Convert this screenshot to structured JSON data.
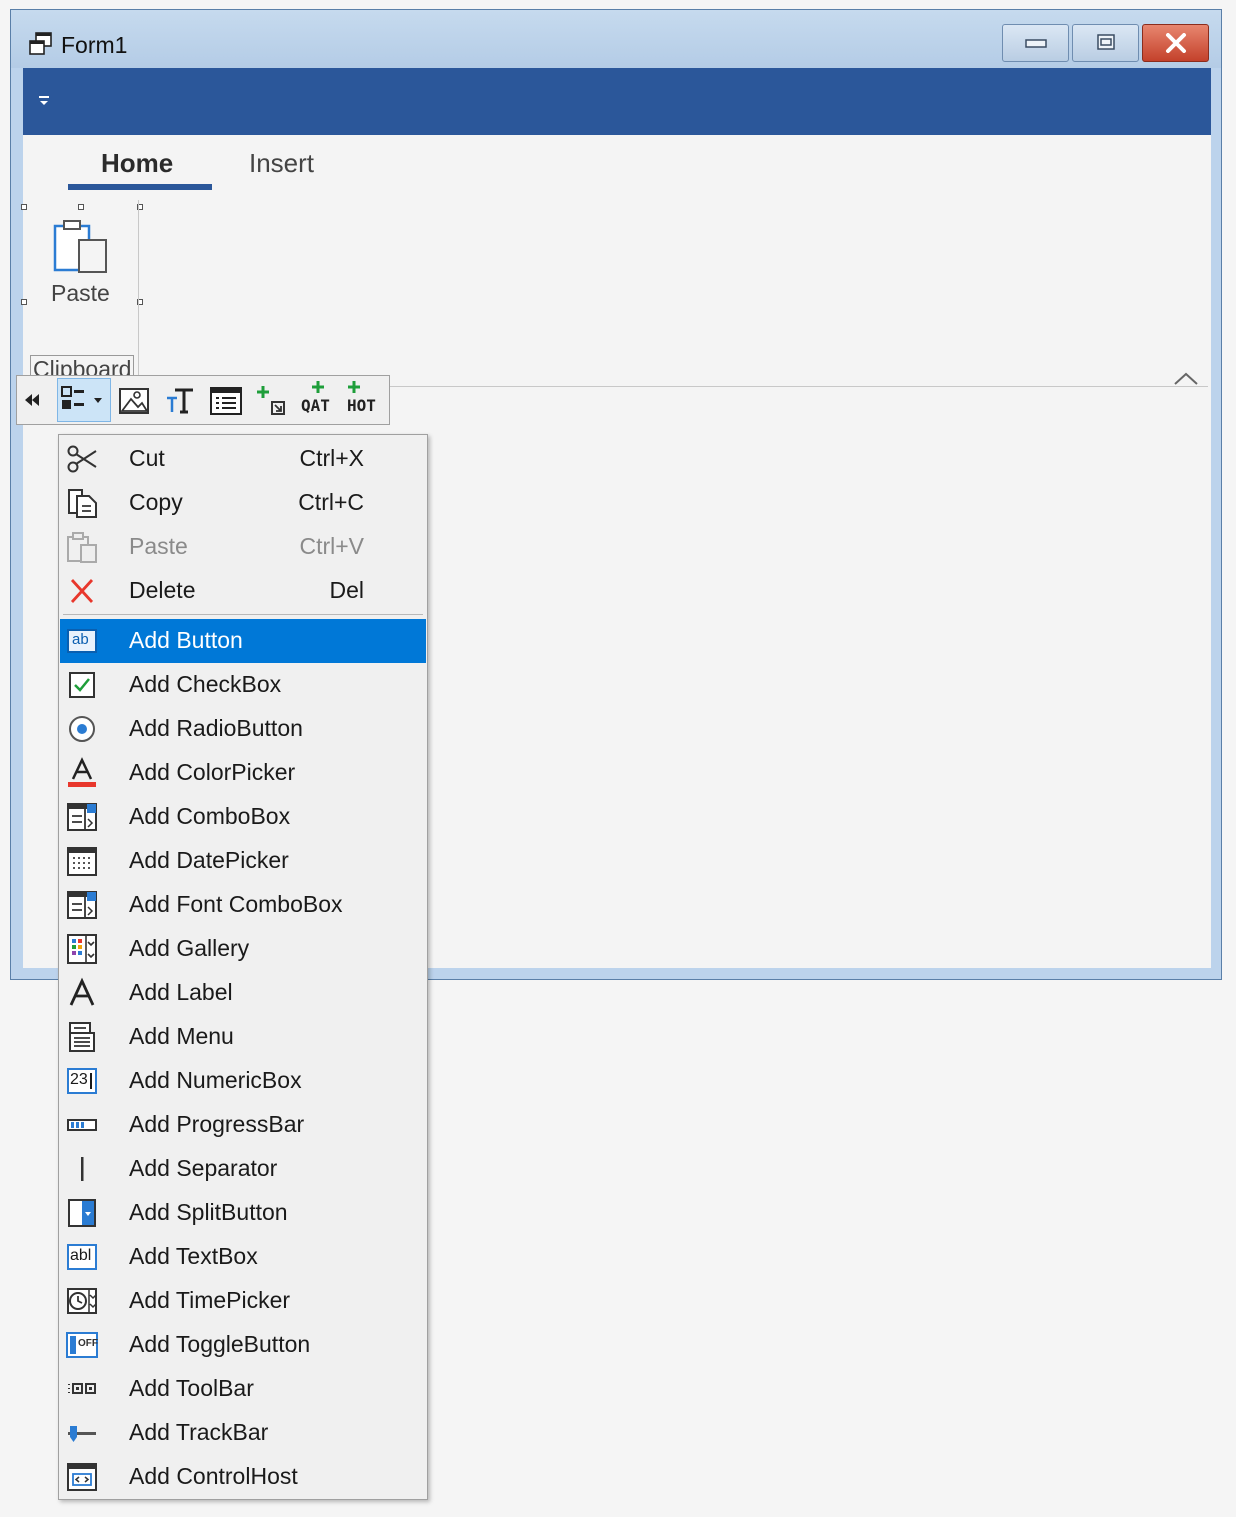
{
  "window": {
    "title": "Form1",
    "icon": "form-icon"
  },
  "ribbon": {
    "tabs": [
      {
        "label": "Home",
        "selected": true
      },
      {
        "label": "Insert",
        "selected": false
      }
    ],
    "group": {
      "name": "Clipboard",
      "buttons": [
        {
          "label": "Paste",
          "icon": "paste-icon"
        }
      ]
    }
  },
  "designer_toolbar": {
    "icons": [
      "collapse-arrows-icon",
      "add-item-dropdown-icon",
      "picture-icon",
      "text-icon",
      "properties-icon",
      "add-item-icon",
      "add-qat-icon",
      "add-hot-icon"
    ],
    "qat_text": "QAT",
    "hot_text": "HOT"
  },
  "context_menu": {
    "edit_items": [
      {
        "label": "Cut",
        "shortcut": "Ctrl+X",
        "icon": "scissors-icon",
        "enabled": true
      },
      {
        "label": "Copy",
        "shortcut": "Ctrl+C",
        "icon": "copy-icon",
        "enabled": true
      },
      {
        "label": "Paste",
        "shortcut": "Ctrl+V",
        "icon": "paste-icon",
        "enabled": false
      },
      {
        "label": "Delete",
        "shortcut": "Del",
        "icon": "delete-icon",
        "enabled": true
      }
    ],
    "add_items": [
      {
        "label": "Add Button",
        "icon": "button-icon",
        "selected": true
      },
      {
        "label": "Add CheckBox",
        "icon": "checkbox-icon"
      },
      {
        "label": "Add RadioButton",
        "icon": "radiobutton-icon"
      },
      {
        "label": "Add ColorPicker",
        "icon": "colorpicker-icon"
      },
      {
        "label": "Add ComboBox",
        "icon": "combobox-icon"
      },
      {
        "label": "Add DatePicker",
        "icon": "datepicker-icon"
      },
      {
        "label": "Add Font ComboBox",
        "icon": "font-combobox-icon"
      },
      {
        "label": "Add Gallery",
        "icon": "gallery-icon"
      },
      {
        "label": "Add Label",
        "icon": "label-icon"
      },
      {
        "label": "Add Menu",
        "icon": "menu-icon"
      },
      {
        "label": "Add NumericBox",
        "icon": "numericbox-icon"
      },
      {
        "label": "Add ProgressBar",
        "icon": "progressbar-icon"
      },
      {
        "label": "Add Separator",
        "icon": "separator-icon"
      },
      {
        "label": "Add SplitButton",
        "icon": "splitbutton-icon"
      },
      {
        "label": "Add TextBox",
        "icon": "textbox-icon"
      },
      {
        "label": "Add TimePicker",
        "icon": "timepicker-icon"
      },
      {
        "label": "Add ToggleButton",
        "icon": "togglebutton-icon"
      },
      {
        "label": "Add ToolBar",
        "icon": "toolbar-icon"
      },
      {
        "label": "Add TrackBar",
        "icon": "trackbar-icon"
      },
      {
        "label": "Add ControlHost",
        "icon": "controlhost-icon"
      }
    ],
    "icon_text": {
      "ab": "ab",
      "num": "23",
      "abl": "abl",
      "off": "OFF"
    }
  },
  "colors": {
    "ribbon_blue": "#2b579a",
    "selection_blue": "#0078d7",
    "delete_red": "#e8372c",
    "check_green": "#1e9e3a"
  }
}
